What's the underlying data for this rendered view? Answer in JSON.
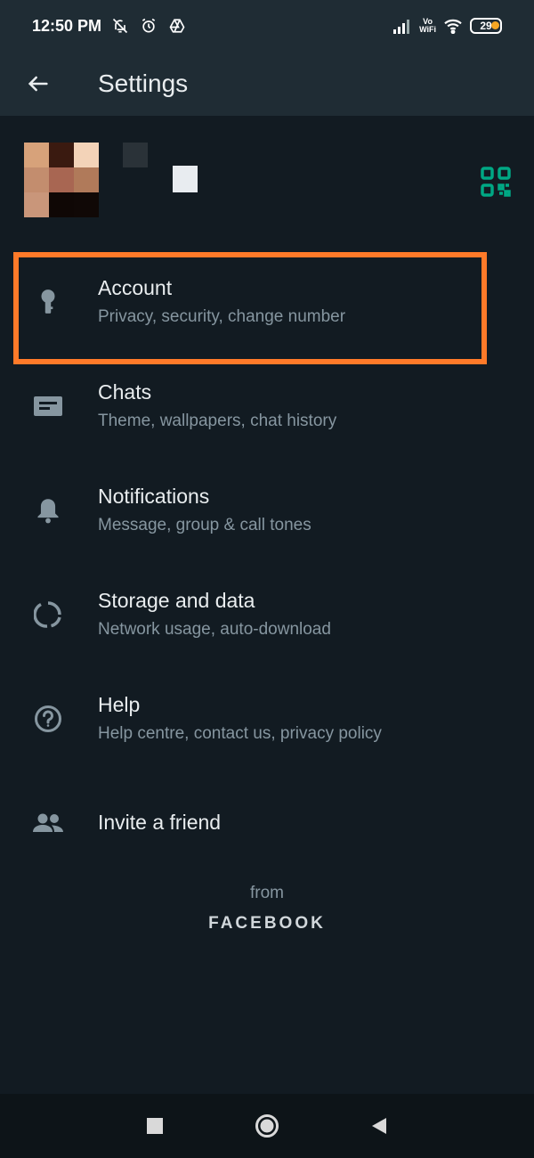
{
  "status_bar": {
    "time": "12:50 PM",
    "icons_left": [
      "mute-bell-icon",
      "alarm-icon",
      "drive-icon"
    ],
    "icons_right": [
      "signal-icon",
      "vowifi-icon",
      "wifi-icon",
      "battery-icon"
    ],
    "vowifi_top": "Vo",
    "vowifi_bottom": "WiFi",
    "battery_level": "29"
  },
  "app_bar": {
    "title": "Settings"
  },
  "profile": {
    "icons": [
      "qr-code-icon"
    ],
    "qr_color": "#00a884"
  },
  "menu": {
    "items": [
      {
        "title": "Account",
        "subtitle": "Privacy, security, change number",
        "icon": "key-icon"
      },
      {
        "title": "Chats",
        "subtitle": "Theme, wallpapers, chat history",
        "icon": "chat-icon"
      },
      {
        "title": "Notifications",
        "subtitle": "Message, group & call tones",
        "icon": "bell-icon"
      },
      {
        "title": "Storage and data",
        "subtitle": "Network usage, auto-download",
        "icon": "storage-icon"
      },
      {
        "title": "Help",
        "subtitle": "Help centre, contact us, privacy policy",
        "icon": "help-icon"
      },
      {
        "title": "Invite a friend",
        "icon": "people-icon"
      }
    ],
    "highlight_color": "#ff7a29"
  },
  "footer": {
    "from": "from",
    "brand": "FACEBOOK"
  },
  "nav_bar": {
    "buttons": [
      "recents-button",
      "home-button",
      "back-button"
    ]
  },
  "colors": {
    "background": "#121b22",
    "bar": "#1f2c34",
    "primary_text": "#e9edef",
    "secondary_text": "#8696a0",
    "accent": "#00a884"
  }
}
